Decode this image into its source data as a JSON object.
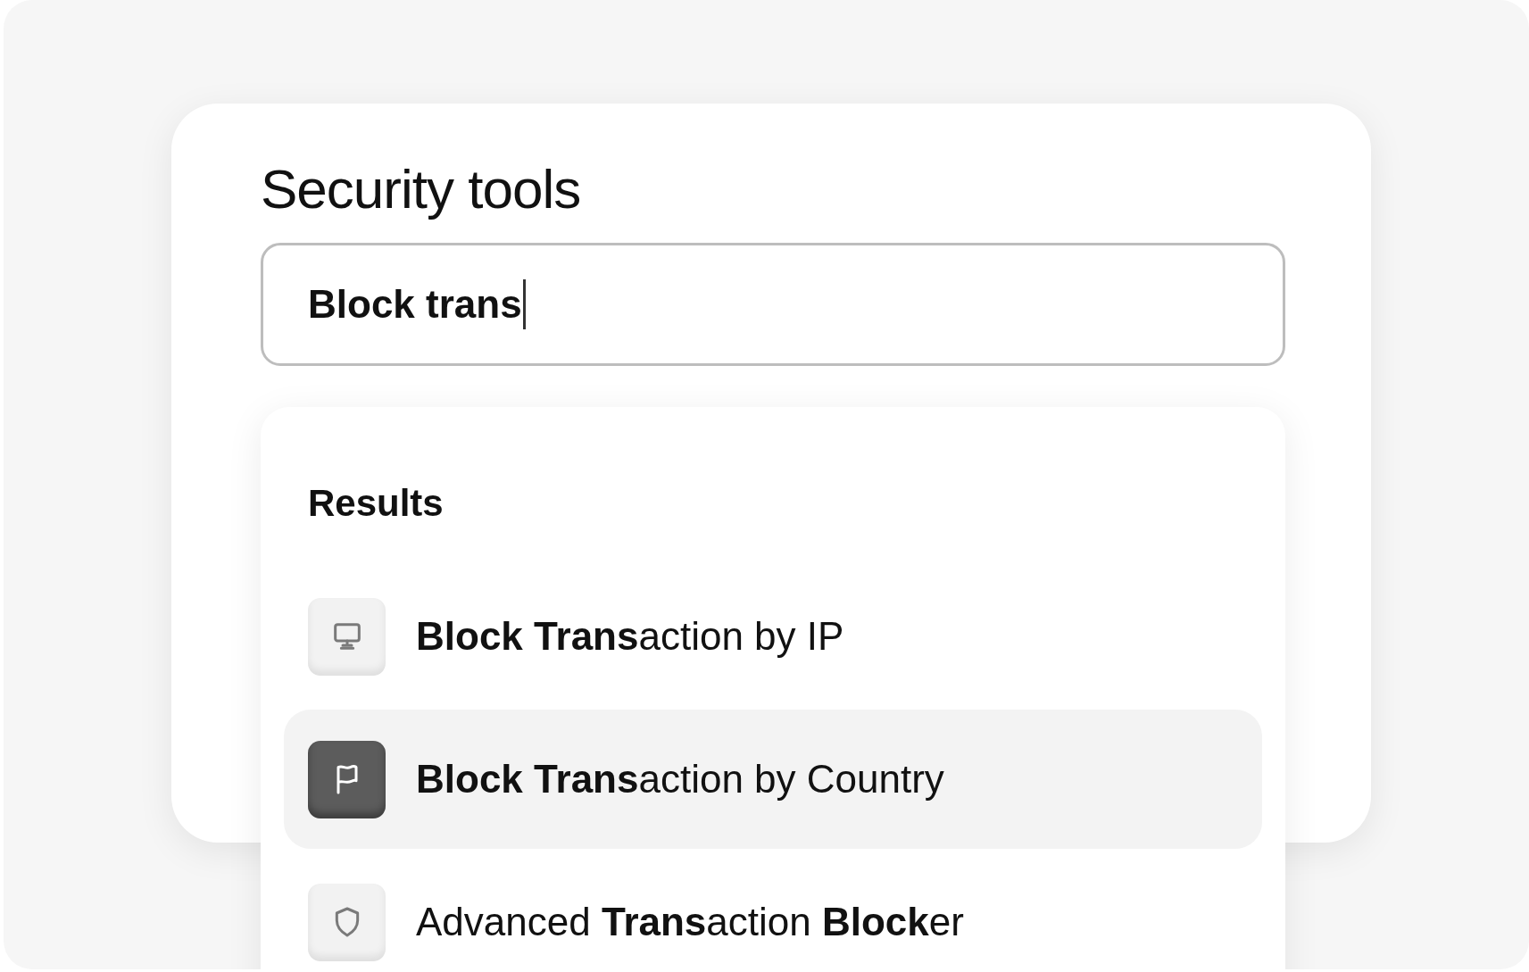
{
  "title": "Security tools",
  "search": {
    "value": "Block trans"
  },
  "results": {
    "heading": "Results",
    "items": [
      {
        "label": "**Block** **Trans**action by IP",
        "kind": "monitor",
        "selected": false
      },
      {
        "label": "**Block** **Trans**action by Country",
        "kind": "flag",
        "selected": true
      },
      {
        "label": "Advanced **Trans**action **Block**er",
        "kind": "shield",
        "selected": false
      }
    ]
  }
}
